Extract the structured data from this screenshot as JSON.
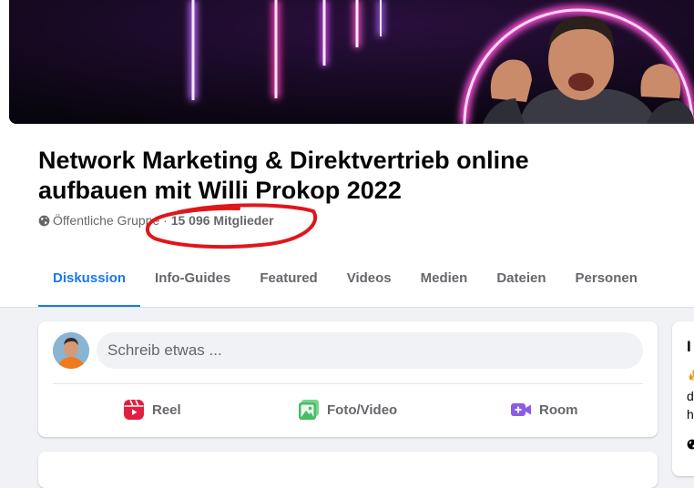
{
  "group": {
    "title": "Network Marketing & Direktvertrieb online aufbauen mit Willi Prokop 2022",
    "privacy": "Öffentliche Gruppe",
    "separator": " · ",
    "members": "15 096 Mitglieder"
  },
  "tabs": [
    "Diskussion",
    "Info-Guides",
    "Featured",
    "Videos",
    "Medien",
    "Dateien",
    "Personen"
  ],
  "active_tab": "Diskussion",
  "composer": {
    "placeholder": "Schreib etwas ...",
    "actions": [
      {
        "label": "Reel",
        "icon": "reel-icon",
        "color": "#e41e3f"
      },
      {
        "label": "Foto/Video",
        "icon": "photo-video-icon",
        "color": "#45bd62"
      },
      {
        "label": "Room",
        "icon": "room-video-icon",
        "color": "#8c5ce8"
      }
    ]
  },
  "sidebar": {
    "title_fragment": "I",
    "lines": [
      "d",
      "h"
    ]
  },
  "colors": {
    "accent": "#1877f2",
    "annotation": "#e0161b",
    "text_secondary": "#65676b"
  }
}
